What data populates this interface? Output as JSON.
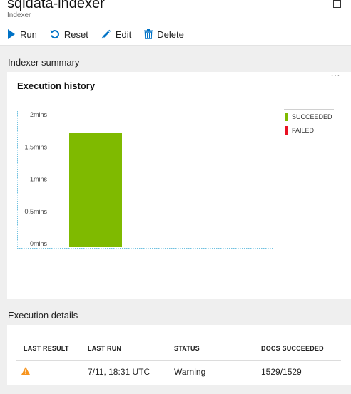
{
  "header": {
    "title": "sqldata-indexer",
    "subtitle": "Indexer"
  },
  "toolbar": {
    "run_label": "Run",
    "reset_label": "Reset",
    "edit_label": "Edit",
    "delete_label": "Delete"
  },
  "summary": {
    "section_label": "Indexer summary",
    "card_title": "Execution history",
    "more_label": "…"
  },
  "chart_data": {
    "type": "bar",
    "title": "Execution history",
    "categories": [
      ""
    ],
    "series": [
      {
        "name": "SUCCEEDED",
        "color": "#7fba00",
        "values": [
          1.72
        ]
      },
      {
        "name": "FAILED",
        "color": "#e81123",
        "values": [
          0
        ]
      }
    ],
    "ylim": [
      0,
      2
    ],
    "yticks": [
      "0mins",
      "0.5mins",
      "1mins",
      "1.5mins",
      "2mins"
    ],
    "legend_position": "right"
  },
  "details": {
    "section_label": "Execution details",
    "columns": [
      "LAST RESULT",
      "LAST RUN",
      "STATUS",
      "DOCS SUCCEEDED"
    ],
    "rows": [
      {
        "last_result_icon": "warning-icon",
        "last_run": "7/11, 18:31 UTC",
        "status": "Warning",
        "docs_succeeded": "1529/1529"
      }
    ]
  },
  "colors": {
    "accent": "#0072c6",
    "succeeded": "#7fba00",
    "failed": "#e81123",
    "warning": "#f7941e",
    "plot_border": "#6fc1e0"
  }
}
